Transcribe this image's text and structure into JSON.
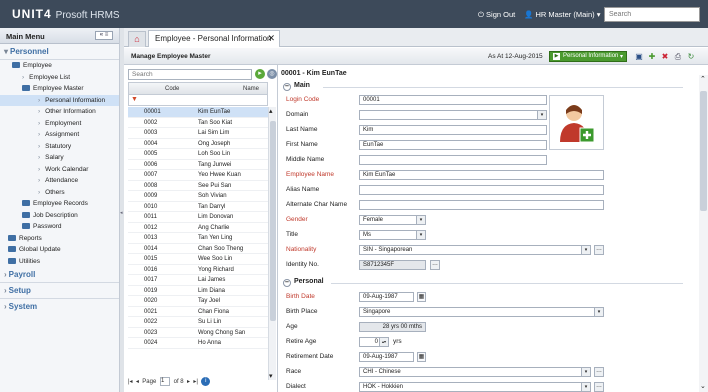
{
  "app": {
    "brand": "UNIT4",
    "product": "Prosoft HRMS"
  },
  "topbar": {
    "signout": "Sign Out",
    "user": "HR Master (Main)",
    "search_placeholder": "Search"
  },
  "sidebar": {
    "title": "Main Menu",
    "sections": {
      "personnel": "Personnel",
      "payroll": "Payroll",
      "setup": "Setup",
      "system": "System"
    },
    "items": [
      {
        "label": "Employee"
      },
      {
        "label": "Employee List"
      },
      {
        "label": "Employee Master"
      },
      {
        "label": "Personal Information"
      },
      {
        "label": "Other Information"
      },
      {
        "label": "Employment"
      },
      {
        "label": "Assignment"
      },
      {
        "label": "Statutory"
      },
      {
        "label": "Salary"
      },
      {
        "label": "Work Calendar"
      },
      {
        "label": "Attendance"
      },
      {
        "label": "Others"
      },
      {
        "label": "Employee Records"
      },
      {
        "label": "Job Description"
      },
      {
        "label": "Password"
      },
      {
        "label": "Reports"
      },
      {
        "label": "Global Update"
      },
      {
        "label": "Utilities"
      }
    ]
  },
  "tabs": {
    "active": "Employee - Personal Information"
  },
  "toolbar": {
    "title": "Manage Employee Master",
    "as_at": "As At 12-Aug-2015",
    "view": "Personal Information"
  },
  "list": {
    "search_placeholder": "Search",
    "columns": [
      "Code",
      "Name"
    ],
    "rows": [
      {
        "code": "00001",
        "name": "Kim EunTae"
      },
      {
        "code": "0002",
        "name": "Tan Soo Kiat"
      },
      {
        "code": "0003",
        "name": "Lai Sim Lim"
      },
      {
        "code": "0004",
        "name": "Ong Joseph"
      },
      {
        "code": "0005",
        "name": "Loh Soo Lin"
      },
      {
        "code": "0006",
        "name": "Tang Junwei"
      },
      {
        "code": "0007",
        "name": "Yeo Hwee Kuan"
      },
      {
        "code": "0008",
        "name": "See Pui San"
      },
      {
        "code": "0009",
        "name": "Soh Vivian"
      },
      {
        "code": "0010",
        "name": "Tan Darryl"
      },
      {
        "code": "0011",
        "name": "Lim Donovan"
      },
      {
        "code": "0012",
        "name": "Ang Charlie"
      },
      {
        "code": "0013",
        "name": "Tan Yen Ling"
      },
      {
        "code": "0014",
        "name": "Chan Soo Theng"
      },
      {
        "code": "0015",
        "name": "Wee Soo Lin"
      },
      {
        "code": "0016",
        "name": "Yong Richard"
      },
      {
        "code": "0017",
        "name": "Lai James"
      },
      {
        "code": "0019",
        "name": "Lim Diana"
      },
      {
        "code": "0020",
        "name": "Tay Joel"
      },
      {
        "code": "0021",
        "name": "Chan Fiona"
      },
      {
        "code": "0022",
        "name": "Su Li Lin"
      },
      {
        "code": "0023",
        "name": "Wong Chong San"
      },
      {
        "code": "0024",
        "name": "Ho Anna"
      }
    ],
    "pager": {
      "page_label": "Page",
      "page": "1",
      "of": "of 8"
    }
  },
  "detail": {
    "title": "00001 - Kim EunTae",
    "main_section": "Main",
    "personal_section": "Personal",
    "fields": {
      "login_code": {
        "label": "Login Code",
        "value": "00001"
      },
      "domain": {
        "label": "Domain",
        "value": ""
      },
      "last_name": {
        "label": "Last Name",
        "value": "Kim"
      },
      "first_name": {
        "label": "First Name",
        "value": "EunTae"
      },
      "middle_name": {
        "label": "Middle Name",
        "value": ""
      },
      "employee_name": {
        "label": "Employee Name",
        "value": "Kim EunTae"
      },
      "alias_name": {
        "label": "Alias Name",
        "value": ""
      },
      "alt_char_name": {
        "label": "Alternate Char Name",
        "value": ""
      },
      "gender": {
        "label": "Gender",
        "value": "Female"
      },
      "title": {
        "label": "Title",
        "value": "Ms"
      },
      "nationality": {
        "label": "Nationality",
        "value": "SIN - Singaporean"
      },
      "identity_no": {
        "label": "Identity No.",
        "value": "S8712345F"
      },
      "birth_date": {
        "label": "Birth Date",
        "value": "09-Aug-1987"
      },
      "birth_place": {
        "label": "Birth Place",
        "value": "Singapore"
      },
      "age": {
        "label": "Age",
        "value": "28 yrs 00 mths"
      },
      "retire_age": {
        "label": "Retire Age",
        "value": "0",
        "unit": "yrs"
      },
      "retirement_date": {
        "label": "Retirement Date",
        "value": "09-Aug-1987"
      },
      "race": {
        "label": "Race",
        "value": "CHI - Chinese"
      },
      "dialect": {
        "label": "Dialect",
        "value": "HOK - Hokkien"
      }
    }
  },
  "colors": {
    "topbar": "#3d4a5a",
    "accent": "#3f6fa4",
    "selected_row": "#cfe1f6",
    "required_label": "#c0392b",
    "view_button": "#4b9a2f"
  }
}
